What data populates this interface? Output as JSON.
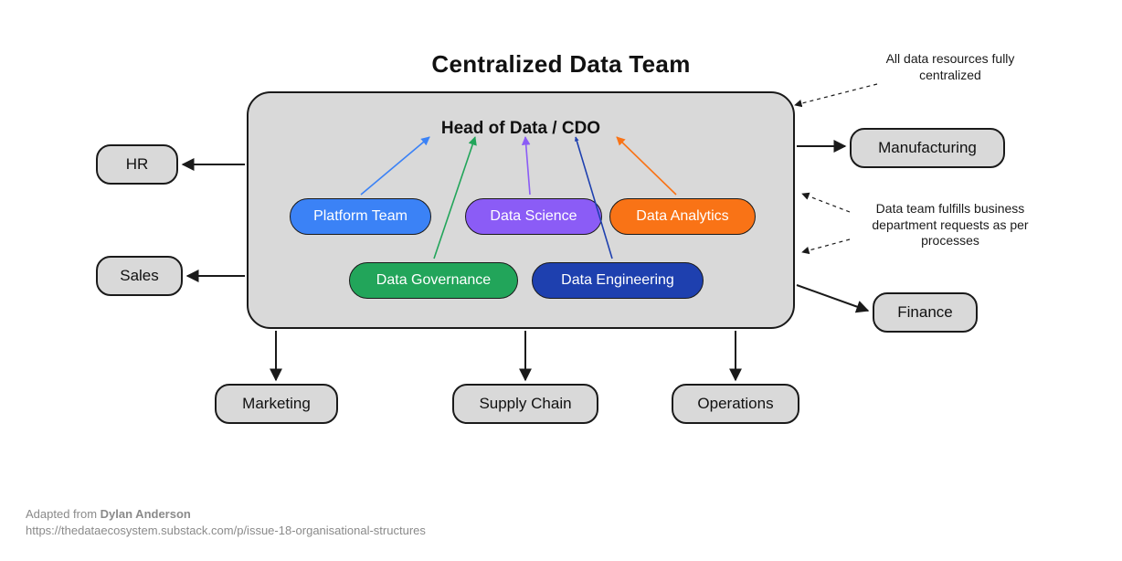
{
  "title": "Centralized Data Team",
  "center": {
    "head_label": "Head of Data / CDO",
    "teams": {
      "platform": "Platform Team",
      "science": "Data Science",
      "analytics": "Data Analytics",
      "governance": "Data Governance",
      "engineering": "Data Engineering"
    }
  },
  "departments": {
    "hr": "HR",
    "sales": "Sales",
    "manufacturing": "Manufacturing",
    "finance": "Finance",
    "marketing": "Marketing",
    "supplychain": "Supply Chain",
    "operations": "Operations"
  },
  "notes": {
    "top": "All data resources fully centralized",
    "mid": "Data team fulfills business department requests as per processes"
  },
  "credit": {
    "prefix": "Adapted from ",
    "author": "Dylan Anderson",
    "url": "https://thedataecosystem.substack.com/p/issue-18-organisational-structures"
  },
  "colors": {
    "box_fill": "#d9d9d9",
    "box_stroke": "#1a1a1a",
    "platform": "#3b82f6",
    "science": "#8b5cf6",
    "analytics": "#f97316",
    "governance": "#22a55a",
    "engineering": "#1e40af"
  }
}
